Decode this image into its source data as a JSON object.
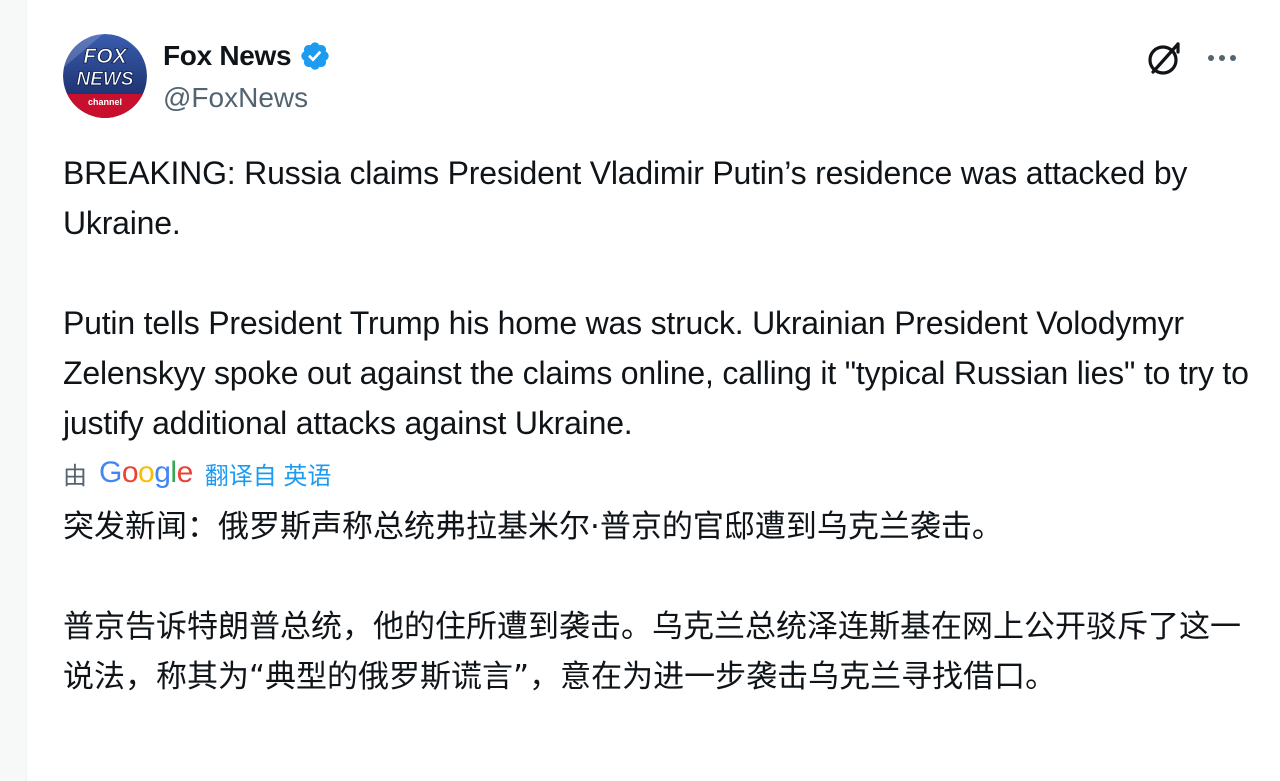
{
  "tweet": {
    "author": {
      "display_name": "Fox News",
      "handle": "@FoxNews",
      "verified": true,
      "avatar_label": "FOX NEWS channel"
    },
    "paragraphs": [
      "BREAKING: Russia claims President Vladimir Putin’s residence was attacked by Ukraine.",
      "Putin tells President Trump his home was struck. Ukrainian President Volodymyr Zelenskyy spoke out against the claims online, calling it \"typical Russian lies\" to try to justify additional attacks against Ukraine."
    ],
    "translation": {
      "prefix": "由",
      "provider": "Google",
      "link_label": "翻译自 英语",
      "paragraphs": [
        "突发新闻：俄罗斯声称总统弗拉基米尔·普京的官邸遭到乌克兰袭击。",
        "普京告诉特朗普总统，他的住所遭到袭击。乌克兰总统泽连斯基在网上公开驳斥了这一说法，称其为“典型的俄罗斯谎言”，意在为进一步袭击乌克兰寻找借口。"
      ]
    }
  },
  "icons": {
    "verified": "verified-badge-icon",
    "grok": "grok-icon",
    "more": "more-options-icon"
  },
  "colors": {
    "text_primary": "#0f1419",
    "text_secondary": "#536471",
    "link_blue": "#1d9bf0",
    "verified_blue": "#1d9bf0",
    "google_blue": "#4285f4",
    "google_red": "#ea4335",
    "google_yellow": "#fbbc05",
    "google_green": "#34a853",
    "fox_navy": "#1c2f6b",
    "fox_red": "#c8102e"
  }
}
